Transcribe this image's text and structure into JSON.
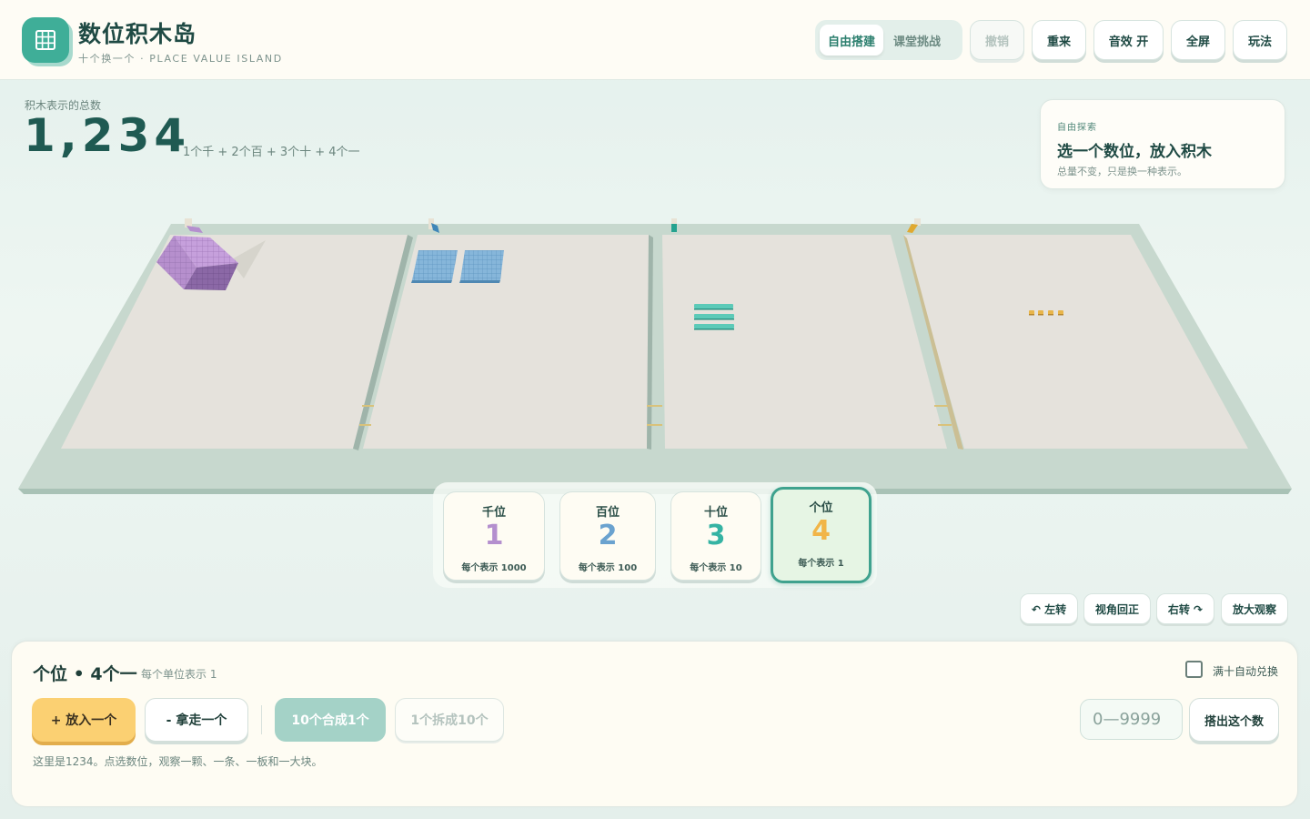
{
  "header": {
    "title": "数位积木岛",
    "subtitle": "十个换一个 · PLACE VALUE ISLAND",
    "logo_icon": "grid-icon",
    "modes": [
      {
        "label": "自由搭建",
        "active": true
      },
      {
        "label": "课堂挑战",
        "active": false
      }
    ],
    "buttons": {
      "undo": "撤销",
      "reset": "重来",
      "sound": "音效 开",
      "fullscreen": "全屏",
      "help": "玩法"
    }
  },
  "total": {
    "label": "积木表示的总数",
    "value": "1,234",
    "breakdown": "1个千 + 2个百 + 3个十 + 4个一"
  },
  "hint": {
    "kicker": "自由探索",
    "title": "选一个数位，放入积木",
    "description": "总量不变，只是换一种表示。"
  },
  "places": [
    {
      "name": "千位",
      "digit": "1",
      "desc": "每个表示 1000",
      "color": "#b48fce",
      "active": false
    },
    {
      "name": "百位",
      "digit": "2",
      "desc": "每个表示 100",
      "color": "#6aa2cf",
      "active": false
    },
    {
      "name": "十位",
      "digit": "3",
      "desc": "每个表示 10",
      "color": "#35b3a3",
      "active": false
    },
    {
      "name": "个位",
      "digit": "4",
      "desc": "每个表示 1",
      "color": "#f1b548",
      "active": true
    }
  ],
  "block_counts": {
    "thousands": 1,
    "hundreds": 2,
    "tens": 3,
    "ones": 4
  },
  "colors": {
    "accent": "#3fae98",
    "thousand_block": "#b48fce",
    "hundred_block": "#7fb2d8",
    "ten_block": "#4fbfae",
    "unit_block": "#e8b54a"
  },
  "view_controls": {
    "rotate_left": "↶ 左转",
    "reset_view": "视角回正",
    "rotate_right": "右转 ↷",
    "zoom": "放大观察"
  },
  "panel": {
    "title": "个位 • 4个一",
    "subtitle": "每个单位表示 1",
    "auto_exchange": "满十自动兑换",
    "auto_exchange_checked": false,
    "add": "+ 放入一个",
    "remove": "- 拿走一个",
    "merge": "10个合成1个",
    "split": "1个拆成10个",
    "input_placeholder": "0—9999",
    "input_value": "",
    "build": "搭出这个数",
    "status": "这里是1234。点选数位，观察一颗、一条、一板和一大块。"
  }
}
